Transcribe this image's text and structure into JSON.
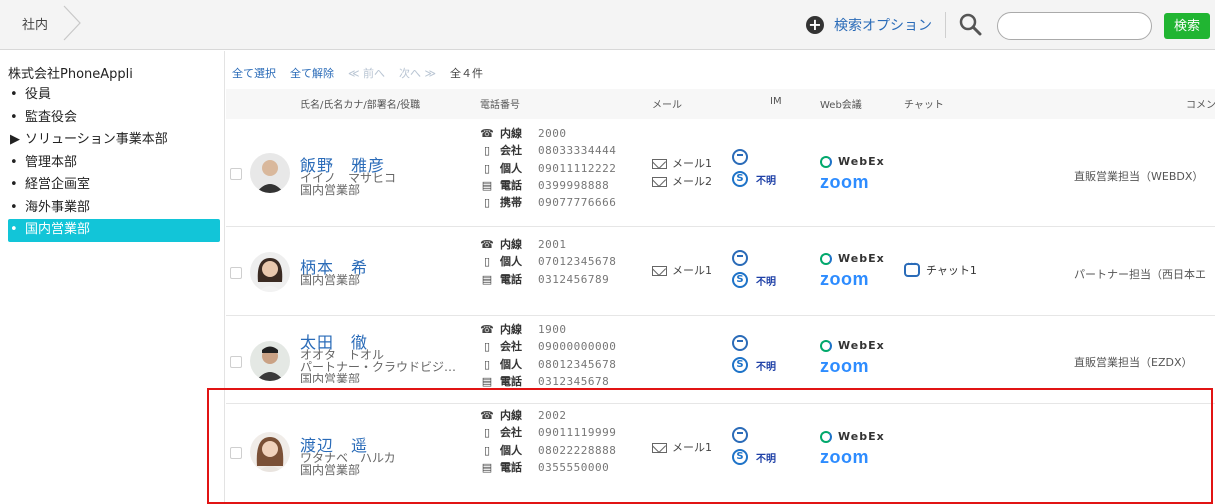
{
  "header": {
    "breadcrumb": "社内",
    "option_label": "検索オプション",
    "search_placeholder": "",
    "search_button": "検索"
  },
  "sidebar": {
    "company": "株式会社PhoneAppli",
    "items": [
      {
        "marker": "•",
        "label": "役員"
      },
      {
        "marker": "•",
        "label": "監査役会"
      },
      {
        "marker": "▶",
        "label": "ソリューション事業本部"
      },
      {
        "marker": "•",
        "label": "管理本部"
      },
      {
        "marker": "•",
        "label": "経営企画室"
      },
      {
        "marker": "•",
        "label": "海外事業部"
      },
      {
        "marker": "•",
        "label": "国内営業部"
      }
    ]
  },
  "toolbar": {
    "select_all": "全て選択",
    "deselect_all": "全て解除",
    "prev": "≪ 前へ",
    "next": "次へ ≫",
    "count": "全４件"
  },
  "columns": {
    "name": "氏名/氏名カナ/部署名/役職",
    "phone": "電話番号",
    "mail": "メール",
    "im": "IM",
    "web": "Web会議",
    "chat": "チャット",
    "comment": "コメン"
  },
  "labels": {
    "unknown": "不明",
    "webex": "WebEx",
    "zoom": "zoom"
  },
  "contacts": [
    {
      "name": "飯野　雅彦",
      "kana": "イイノ　マサヒコ",
      "dept": "国内営業部",
      "phones": [
        {
          "icon": "☎",
          "label": "内線",
          "number": "2000"
        },
        {
          "icon": "▯",
          "label": "会社",
          "number": "08033334444"
        },
        {
          "icon": "▯",
          "label": "個人",
          "number": "09011112222"
        },
        {
          "icon": "▤",
          "label": "電話",
          "number": "0399998888"
        },
        {
          "icon": "▯",
          "label": "携帯",
          "number": "09077776666"
        }
      ],
      "mails": [
        "メール1",
        "メール2"
      ],
      "chat": "",
      "comment": "直販営業担当（WEBDX）"
    },
    {
      "name": "柄本　希",
      "kana": "",
      "dept": "国内営業部",
      "phones": [
        {
          "icon": "☎",
          "label": "内線",
          "number": "2001"
        },
        {
          "icon": "▯",
          "label": "個人",
          "number": "07012345678"
        },
        {
          "icon": "▤",
          "label": "電話",
          "number": "0312456789"
        }
      ],
      "mails": [
        "メール1"
      ],
      "chat": "チャット1",
      "comment": "パートナー担当（西日本エ"
    },
    {
      "name": "太田　徹",
      "kana": "オオタ　トオル",
      "dept": "パートナー・クラウドビジ…",
      "dept2": "国内営業部",
      "phones": [
        {
          "icon": "☎",
          "label": "内線",
          "number": "1900"
        },
        {
          "icon": "▯",
          "label": "会社",
          "number": "09000000000"
        },
        {
          "icon": "▯",
          "label": "個人",
          "number": "08012345678"
        },
        {
          "icon": "▤",
          "label": "電話",
          "number": "0312345678"
        }
      ],
      "mails": [],
      "chat": "",
      "comment": "直販営業担当（EZDX）"
    },
    {
      "name": "渡辺　遥",
      "kana": "ワタナベ　ハルカ",
      "dept": "国内営業部",
      "phones": [
        {
          "icon": "☎",
          "label": "内線",
          "number": "2002"
        },
        {
          "icon": "▯",
          "label": "会社",
          "number": "09011119999"
        },
        {
          "icon": "▯",
          "label": "個人",
          "number": "08022228888"
        },
        {
          "icon": "▤",
          "label": "電話",
          "number": "0355550000"
        }
      ],
      "mails": [
        "メール1"
      ],
      "chat": "",
      "comment": ""
    }
  ],
  "colors": {
    "accent_blue": "#2a6bb8",
    "search_green": "#21b532",
    "active_cyan": "#12c5d8",
    "highlight_red": "#e11414",
    "zoom_blue": "#2d8cff"
  }
}
